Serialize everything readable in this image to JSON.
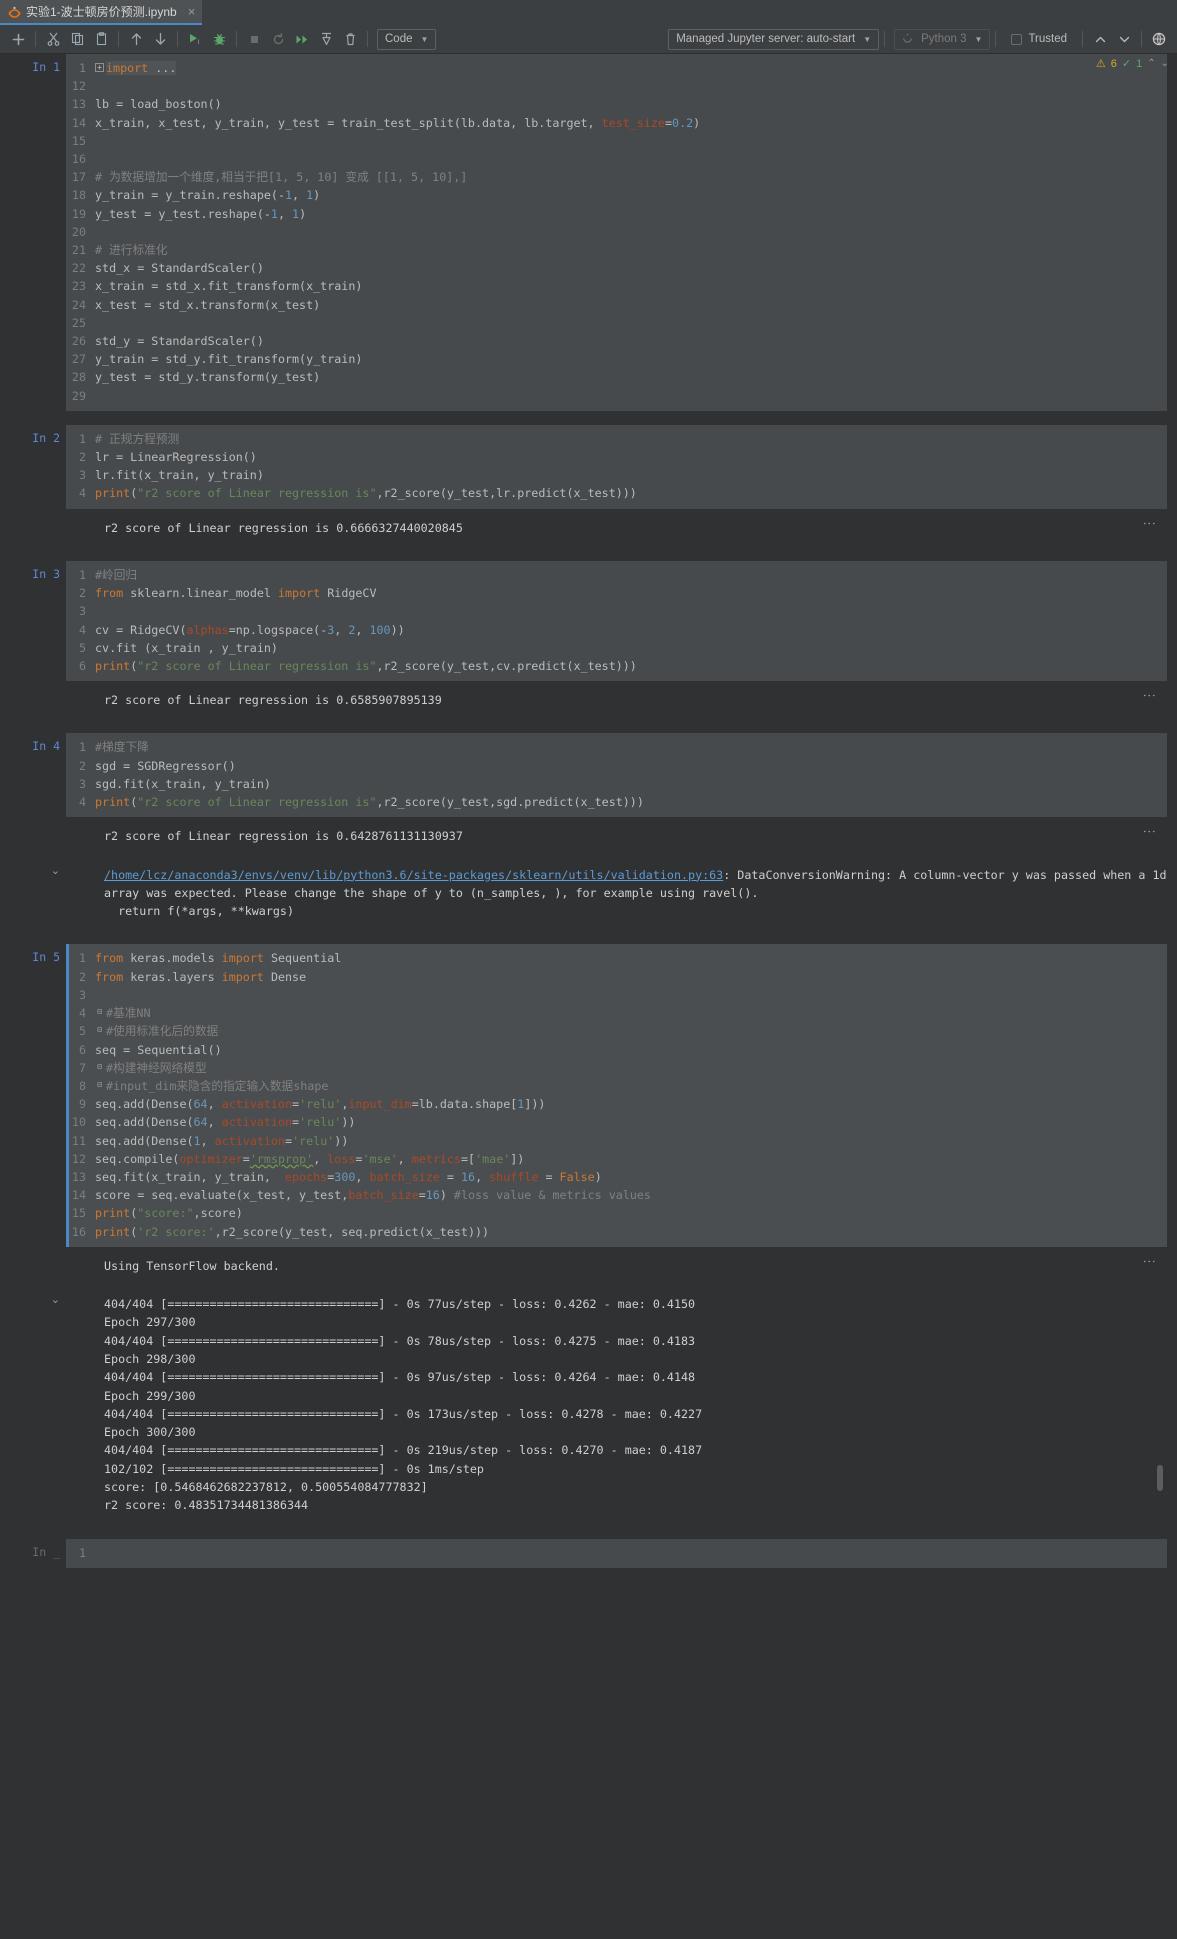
{
  "window": {
    "tab": {
      "title": "实验1-波士顿房价预测.ipynb",
      "icon": "jupyter-notebook-icon",
      "close": "×"
    }
  },
  "toolbar": {
    "buttons": [
      {
        "name": "add-cell-button",
        "glyph": "+"
      },
      {
        "name": "cut-cell-button",
        "glyph": "✂"
      },
      {
        "name": "copy-cell-button",
        "glyph": "❐"
      },
      {
        "name": "paste-cell-button",
        "glyph": "❏"
      },
      {
        "name": "move-cell-up-button",
        "glyph": "↑"
      },
      {
        "name": "move-cell-down-button",
        "glyph": "↓"
      },
      {
        "name": "run-cell-button",
        "glyph": "▶"
      },
      {
        "name": "debug-cell-button",
        "glyph": "🐞"
      },
      {
        "name": "interrupt-kernel-button",
        "glyph": "■"
      },
      {
        "name": "restart-kernel-button",
        "glyph": "↻"
      },
      {
        "name": "run-all-cells-button",
        "glyph": "▶▶"
      },
      {
        "name": "restart-and-run-button",
        "glyph": "⤓"
      },
      {
        "name": "delete-cell-button",
        "glyph": "🗑"
      }
    ],
    "cell_type": "Code",
    "server": "Managed Jupyter server: auto-start",
    "kernel": "Python 3",
    "trusted_label": "Trusted",
    "nav_up": "⌃",
    "nav_down": "⌄",
    "globe_icon": "globe-icon"
  },
  "inspections": {
    "warning_count": "6",
    "ok_count": "1",
    "warning_glyph": "⚠",
    "ok_glyph": "✓",
    "up": "⌃",
    "down": "⌄"
  },
  "cells": [
    {
      "prompt": "In 1",
      "active": false,
      "lines": [
        {
          "n": "1",
          "fold": "+",
          "html": "<span class=\"hl-import\"><span class=\"kw\">import</span> ...</span>"
        },
        {
          "n": "12",
          "html": ""
        },
        {
          "n": "13",
          "html": "lb = load_boston()"
        },
        {
          "n": "14",
          "html": "x_train, x_test, y_train, y_test = train_test_split(lb.data, lb.target, <span class=\"kwarg\">test_size</span>=<span class=\"num\">0.2</span>)"
        },
        {
          "n": "15",
          "html": ""
        },
        {
          "n": "16",
          "html": ""
        },
        {
          "n": "17",
          "html": "<span class=\"com\"># 为数据增加一个维度,相当于把[1, 5, 10] 变成 [[1, 5, 10],]</span>"
        },
        {
          "n": "18",
          "html": "y_train = y_train.reshape(-<span class=\"num\">1</span>, <span class=\"num\">1</span>)"
        },
        {
          "n": "19",
          "html": "y_test = y_test.reshape(-<span class=\"num\">1</span>, <span class=\"num\">1</span>)"
        },
        {
          "n": "20",
          "html": ""
        },
        {
          "n": "21",
          "html": "<span class=\"com\"># 进行标准化</span>"
        },
        {
          "n": "22",
          "html": "std_x = StandardScaler()"
        },
        {
          "n": "23",
          "html": "x_train = std_x.fit_transform(x_train)"
        },
        {
          "n": "24",
          "html": "x_test = std_x.transform(x_test)"
        },
        {
          "n": "25",
          "html": ""
        },
        {
          "n": "26",
          "html": "std_y = StandardScaler()"
        },
        {
          "n": "27",
          "html": "y_train = std_y.fit_transform(y_train)"
        },
        {
          "n": "28",
          "html": "y_test = std_y.transform(y_test)"
        },
        {
          "n": "29",
          "html": ""
        }
      ],
      "outputs": []
    },
    {
      "prompt": "In 2",
      "active": false,
      "lines": [
        {
          "n": "1",
          "html": "<span class=\"com\"># 正规方程预测</span>"
        },
        {
          "n": "2",
          "html": "lr = LinearRegression()"
        },
        {
          "n": "3",
          "html": "lr.fit(x_train, y_train)"
        },
        {
          "n": "4",
          "html": "<span class=\"kw\">print</span>(<span class=\"str\">\"r2 score of Linear regression is\"</span>,r2_score(y_test,lr.predict(x_test)))"
        }
      ],
      "outputs": [
        {
          "type": "stream",
          "text": "r2 score of Linear regression is 0.6666327440020845",
          "dots": true
        }
      ]
    },
    {
      "prompt": "In 3",
      "active": false,
      "lines": [
        {
          "n": "1",
          "html": "<span class=\"com\">#岭回归</span>"
        },
        {
          "n": "2",
          "html": "<span class=\"kw\">from</span> sklearn.linear_model <span class=\"kw\">import</span> RidgeCV"
        },
        {
          "n": "3",
          "html": ""
        },
        {
          "n": "4",
          "html": "cv = RidgeCV(<span class=\"kwarg\">alphas</span>=np.logspace(-<span class=\"num\">3</span>, <span class=\"num\">2</span>, <span class=\"num\">100</span>))"
        },
        {
          "n": "5",
          "html": "cv.fit (x_train , y_train)"
        },
        {
          "n": "6",
          "html": "<span class=\"kw\">print</span>(<span class=\"str\">\"r2 score of Linear regression is\"</span>,r2_score(y_test,cv.predict(x_test)))"
        }
      ],
      "outputs": [
        {
          "type": "stream",
          "text": "r2 score of Linear regression is 0.6585907895139",
          "dots": true
        }
      ]
    },
    {
      "prompt": "In 4",
      "active": false,
      "lines": [
        {
          "n": "1",
          "html": "<span class=\"com\">#梯度下降</span>"
        },
        {
          "n": "2",
          "html": "sgd = SGDRegressor()"
        },
        {
          "n": "3",
          "html": "sgd.fit(x_train, y_train)"
        },
        {
          "n": "4",
          "html": "<span class=\"kw\">print</span>(<span class=\"str\">\"r2 score of Linear regression is\"</span>,r2_score(y_test,sgd.predict(x_test)))"
        }
      ],
      "outputs": [
        {
          "type": "stream",
          "text": "r2 score of Linear regression is 0.6428761131130937",
          "dots": true
        },
        {
          "type": "warning",
          "chevron": "⌄",
          "link": "/home/lcz/anaconda3/envs/venv/lib/python3.6/site-packages/sklearn/utils/validation.py:63",
          "text": ": DataConversionWarning: A column-vector y was passed when a 1d array was expected. Please change the shape of y to (n_samples, ), for example using ravel().",
          "text2": "  return f(*args, **kwargs)"
        }
      ]
    },
    {
      "prompt": "In 5",
      "active": true,
      "lines": [
        {
          "n": "1",
          "html": "<span class=\"kw\">from</span> keras.models <span class=\"kw\">import</span> Sequential"
        },
        {
          "n": "2",
          "html": "<span class=\"kw\">from</span> keras.layers <span class=\"kw\">import</span> Dense"
        },
        {
          "n": "3",
          "html": ""
        },
        {
          "n": "4",
          "fold": "-",
          "html": "<span class=\"com\">#基准NN</span>"
        },
        {
          "n": "5",
          "fold": "-",
          "html": "<span class=\"com\">#使用标准化后的数据</span>"
        },
        {
          "n": "6",
          "html": "seq = Sequential()"
        },
        {
          "n": "7",
          "fold": "-",
          "html": "<span class=\"com\">#构建神经网络模型</span>"
        },
        {
          "n": "8",
          "fold": "-",
          "html": "<span class=\"com\">#input_dim来隐含的指定输入数据shape</span>"
        },
        {
          "n": "9",
          "html": "seq.add(Dense(<span class=\"num\">64</span>, <span class=\"kwarg\">activation</span>=<span class=\"str\">'relu'</span>,<span class=\"kwarg\">input_dim</span>=lb.data.shape[<span class=\"num\">1</span>]))"
        },
        {
          "n": "10",
          "html": "seq.add(Dense(<span class=\"num\">64</span>, <span class=\"kwarg\">activation</span>=<span class=\"str\">'relu'</span>))"
        },
        {
          "n": "11",
          "html": "seq.add(Dense(<span class=\"num\">1</span>, <span class=\"kwarg\">activation</span>=<span class=\"str\">'relu'</span>))"
        },
        {
          "n": "12",
          "html": "seq.compile(<span class=\"kwarg\">optimizer</span>=<span class=\"str wavy\">'rmsprop'</span>, <span class=\"kwarg\">loss</span>=<span class=\"str\">'mse'</span>, <span class=\"kwarg\">metrics</span>=[<span class=\"str\">'mae'</span>])"
        },
        {
          "n": "13",
          "html": "seq.fit(x_train, y_train,  <span class=\"kwarg\">epochs</span>=<span class=\"num\">300</span>, <span class=\"kwarg\">batch_size</span> = <span class=\"num\">16</span>, <span class=\"kwarg\">shuffle</span> = <span class=\"kw\">False</span>)"
        },
        {
          "n": "14",
          "html": "score = seq.evaluate(x_test, y_test,<span class=\"kwarg\">batch_size</span>=<span class=\"num\">16</span>) <span class=\"com\">#loss value &amp; metrics values</span>"
        },
        {
          "n": "15",
          "html": "<span class=\"kw\">print</span>(<span class=\"str\">\"score:\"</span>,score)"
        },
        {
          "n": "16",
          "html": "<span class=\"kw\">print</span>(<span class=\"str\">'r2 score:'</span>,r2_score(y_test, seq.predict(x_test)))"
        }
      ],
      "outputs": [
        {
          "type": "stream",
          "text": "Using TensorFlow backend.",
          "dots": true
        },
        {
          "type": "scrolled",
          "chevron": "⌄",
          "lines": [
            "404/404 [==============================] - 0s 77us/step - loss: 0.4262 - mae: 0.4150",
            "Epoch 297/300",
            "404/404 [==============================] - 0s 78us/step - loss: 0.4275 - mae: 0.4183",
            "Epoch 298/300",
            "404/404 [==============================] - 0s 97us/step - loss: 0.4264 - mae: 0.4148",
            "Epoch 299/300",
            "404/404 [==============================] - 0s 173us/step - loss: 0.4278 - mae: 0.4227",
            "Epoch 300/300",
            "404/404 [==============================] - 0s 219us/step - loss: 0.4270 - mae: 0.4187",
            "102/102 [==============================] - 0s 1ms/step",
            "score: [0.5468462682237812, 0.500554084777832]",
            "r2 score: 0.48351734481386344"
          ]
        }
      ]
    },
    {
      "prompt": "In _",
      "active": false,
      "lines": [
        {
          "n": "1",
          "html": ""
        }
      ],
      "outputs": []
    }
  ]
}
